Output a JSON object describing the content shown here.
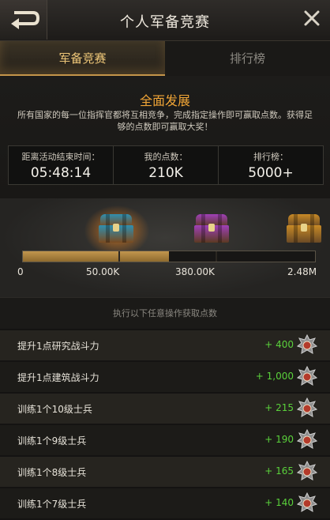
{
  "header": {
    "title": "个人军备竞赛",
    "back_icon": "back-arrow-icon",
    "close_icon": "close-icon"
  },
  "tabs": [
    {
      "label": "军备竞赛",
      "active": true
    },
    {
      "label": "排行榜",
      "active": false
    }
  ],
  "intro": {
    "title": "全面发展",
    "description": "所有国家的每一位指挥官都将互相竞争，完成指定操作即可赢取点数。获得足够的点数即可赢取大奖！"
  },
  "stats": [
    {
      "label": "距离活动结束时间：",
      "value": "05:48:14"
    },
    {
      "label": "我的点数：",
      "value": "210K"
    },
    {
      "label": "排行榜：",
      "value": "5000+"
    }
  ],
  "rewards": {
    "chests": [
      {
        "name": "blue-chest-icon",
        "color": "#2f8fb0",
        "trim": "#7a4a1f"
      },
      {
        "name": "purple-chest-icon",
        "color": "#a040b8",
        "trim": "#5b3a22"
      },
      {
        "name": "orange-chest-icon",
        "color": "#c88a26",
        "trim": "#6b4a25"
      }
    ],
    "milestone_labels": [
      "0",
      "50.00K",
      "380.00K",
      "2.48M"
    ],
    "progress_fraction": 0.5
  },
  "tasks": {
    "header": "执行以下任意操作获取点数",
    "items": [
      {
        "label": "提升1点研究战斗力",
        "points": "+ 400"
      },
      {
        "label": "提升1点建筑战斗力",
        "points": "+ 1,000"
      },
      {
        "label": "训练1个10级士兵",
        "points": "+ 215"
      },
      {
        "label": "训练1个9级士兵",
        "points": "+ 190"
      },
      {
        "label": "训练1个8级士兵",
        "points": "+ 165"
      },
      {
        "label": "训练1个7级士兵",
        "points": "+ 140"
      }
    ],
    "badge_icon": "rank-medal-icon"
  },
  "colors": {
    "accent_gold": "#f0c879",
    "title_orange": "#f0a536",
    "points_green": "#5ad13b"
  }
}
